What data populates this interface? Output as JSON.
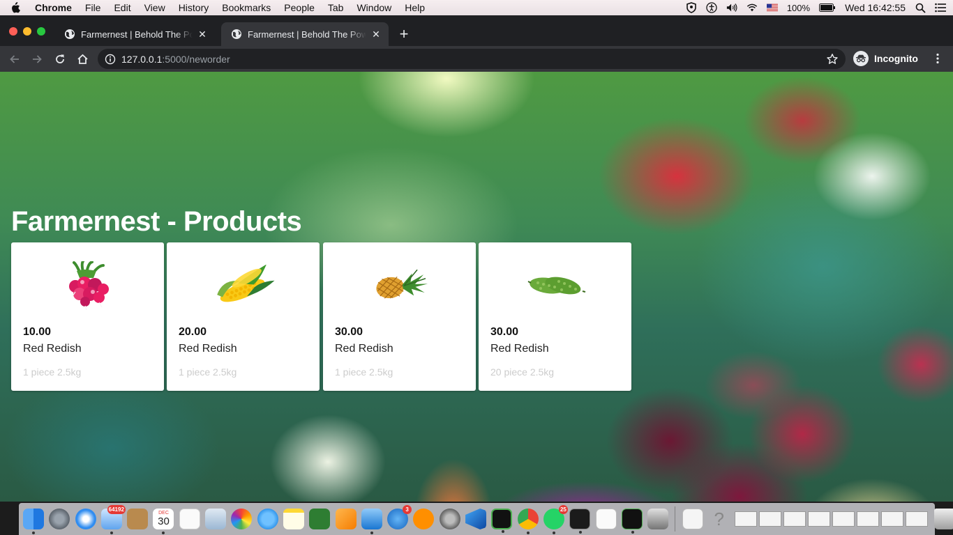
{
  "menubar": {
    "app_name": "Chrome",
    "items": [
      "File",
      "Edit",
      "View",
      "History",
      "Bookmarks",
      "People",
      "Tab",
      "Window",
      "Help"
    ],
    "battery": "100%",
    "clock": "Wed 16:42:55"
  },
  "tabs": [
    {
      "title": "Farmernest | Behold The Power",
      "active": false
    },
    {
      "title": "Farmernest | Behold The Power",
      "active": true
    }
  ],
  "toolbar": {
    "url_host": "127.0.0.1",
    "url_rest": ":5000/neworder",
    "profile_label": "Incognito"
  },
  "page": {
    "title": "Farmernest - Products",
    "products": [
      {
        "price": "10.00",
        "name": "Red Redish",
        "desc": "1 piece 2.5kg",
        "image": "radish-image"
      },
      {
        "price": "20.00",
        "name": "Red Redish",
        "desc": "1 piece 2.5kg",
        "image": "corn-image"
      },
      {
        "price": "30.00",
        "name": "Red Redish",
        "desc": "1 piece 2.5kg",
        "image": "pineapple-image"
      },
      {
        "price": "30.00",
        "name": "Red Redish",
        "desc": "20 piece 2.5kg",
        "image": "bitter-gourd-image"
      }
    ]
  },
  "dock": {
    "badges": {
      "mail": "64192",
      "calendar_day": "30",
      "calendar_month": "DEC",
      "appstore": "3",
      "whatsapp": "25"
    }
  },
  "colors": {
    "tab_strip": "#1f2023",
    "toolbar": "#35363a",
    "omnibox": "#202124",
    "card_bg": "#ffffff",
    "title_text": "#ffffff"
  }
}
